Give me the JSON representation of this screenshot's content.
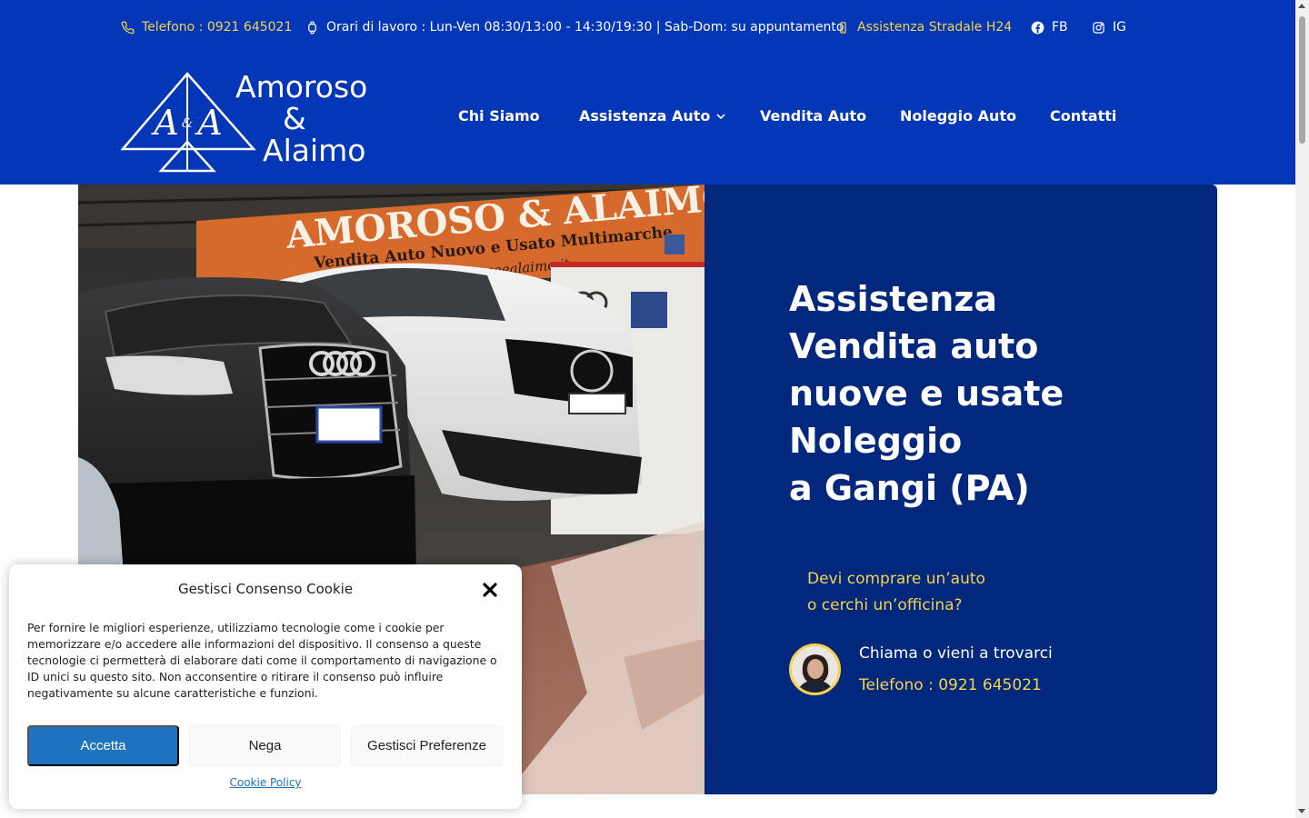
{
  "topbar": {
    "phone": "Telefono : 0921 645021",
    "hours": "Orari di lavoro : Lun-Ven 08:30/13:00 - 14:30/19:30 | Sab-Dom: su appuntamento",
    "roadside": "Assistenza Stradale H24",
    "fb": "FB",
    "ig": "IG"
  },
  "logo": {
    "mark_a1": "A",
    "mark_amp": "&",
    "mark_a2": "A",
    "line1": "Amoroso",
    "line2": "&",
    "line3": "Alaimo"
  },
  "nav": {
    "items": [
      {
        "label": "Chi Siamo"
      },
      {
        "label": "Assistenza Auto"
      },
      {
        "label": "Vendita Auto"
      },
      {
        "label": "Noleggio Auto"
      },
      {
        "label": "Contatti"
      }
    ]
  },
  "hero": {
    "image_alt": "AMOROSO & ALAIMO — Vendita Auto Nuovo e Usato Multimarche",
    "banner_title": "AMOROSO & ALAIMO",
    "banner_subtitle": "Vendita Auto Nuovo e Usato Multimarche",
    "banner_url": "www.amorosoealaimo.it",
    "title_lines": [
      "Assistenza",
      "Vendita auto",
      "nuove e usate",
      "Noleggio",
      "a Gangi (PA)"
    ],
    "question_lines": [
      "Devi comprare un’auto",
      "o cerchi un’officina?"
    ],
    "contact_cta": "Chiama o vieni a trovarci",
    "contact_phone": "Telefono : 0921 645021"
  },
  "cookie": {
    "title": "Gestisci Consenso Cookie",
    "body": "Per fornire le migliori esperienze, utilizziamo tecnologie come i cookie per memorizzare e/o accedere alle informazioni del dispositivo. Il consenso a queste tecnologie ci permetterà di elaborare dati come il comportamento di navigazione o ID unici su questo sito. Non acconsentire o ritirare il consenso può influire negativamente su alcune caratteristiche e funzioni.",
    "accept": "Accetta",
    "deny": "Nega",
    "preferences": "Gestisci Preferenze",
    "policy": "Cookie Policy"
  },
  "colors": {
    "header_blue": "#0337b8",
    "panel_blue": "#02287e",
    "accent_yellow": "#f5d34a",
    "button_blue": "#1e73be"
  },
  "icons": {
    "phone": "phone-icon",
    "hours": "watch-icon",
    "roadside": "mobile-icon",
    "facebook": "facebook-icon",
    "instagram": "instagram-icon",
    "dropdown": "chevron-down-icon",
    "close": "close-icon"
  }
}
